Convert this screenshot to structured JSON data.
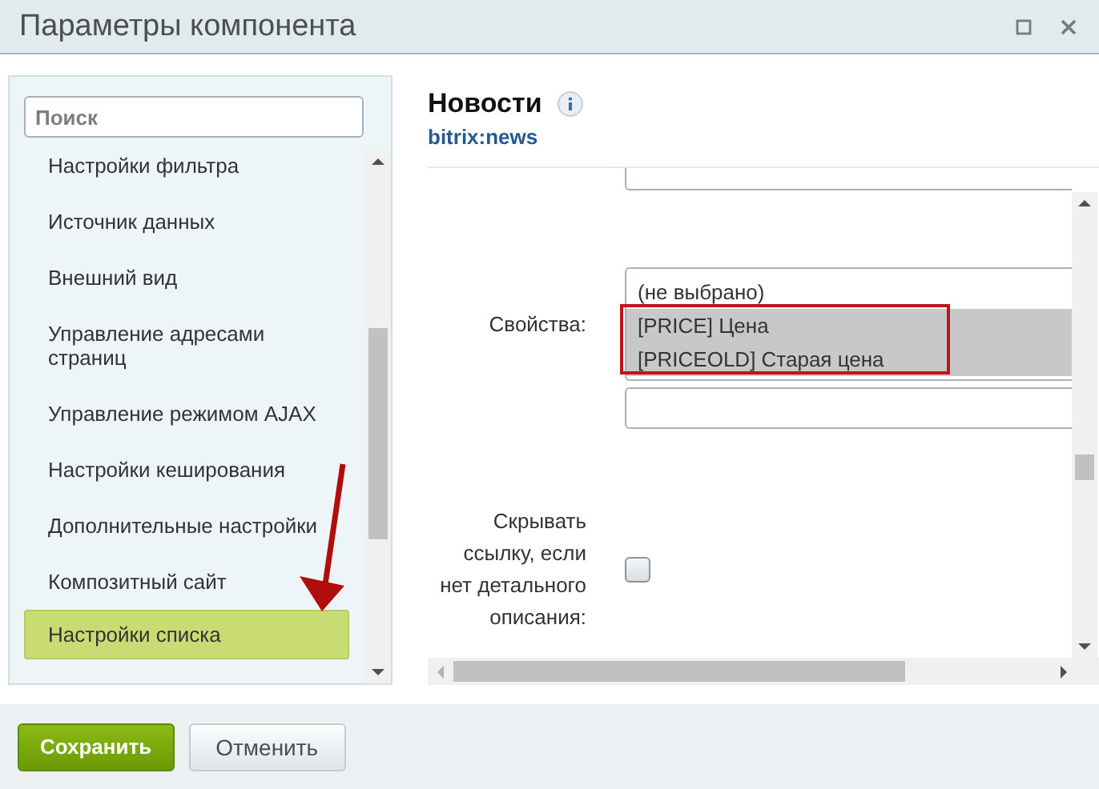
{
  "window": {
    "title": "Параметры компонента"
  },
  "sidebar": {
    "search": {
      "placeholder": "Поиск"
    },
    "items": [
      {
        "label": "Настройки фильтра",
        "selected": false
      },
      {
        "label": "Источник данных",
        "selected": false
      },
      {
        "label": "Внешний вид",
        "selected": false
      },
      {
        "label": "Управление адресами страниц",
        "selected": false
      },
      {
        "label": "Управление режимом AJAX",
        "selected": false
      },
      {
        "label": "Настройки кеширования",
        "selected": false
      },
      {
        "label": "Дополнительные настройки",
        "selected": false
      },
      {
        "label": "Композитный сайт",
        "selected": false
      },
      {
        "label": "Настройки списка",
        "selected": true
      }
    ]
  },
  "annotation": {
    "kind": "arrow"
  },
  "component": {
    "title": "Новости",
    "code": "bitrix:news"
  },
  "form": {
    "rows": [
      {
        "kind": "field"
      },
      {
        "kind": "multiselect",
        "label": "Свойства:",
        "options": [
          {
            "label": "(не выбрано)",
            "selected": false,
            "highlighted": false
          },
          {
            "label": "[PRICE] Цена",
            "selected": true,
            "highlighted": true
          },
          {
            "label": "[PRICEOLD] Старая цена",
            "selected": true,
            "highlighted": true
          }
        ]
      },
      {
        "kind": "field"
      },
      {
        "kind": "checkbox",
        "label": "Скрывать ссылку, если нет детального описания:",
        "checked": false
      }
    ]
  },
  "buttons": [
    {
      "label": "Сохранить",
      "kind": "primary"
    },
    {
      "label": "Отменить",
      "kind": "secondary"
    }
  ]
}
